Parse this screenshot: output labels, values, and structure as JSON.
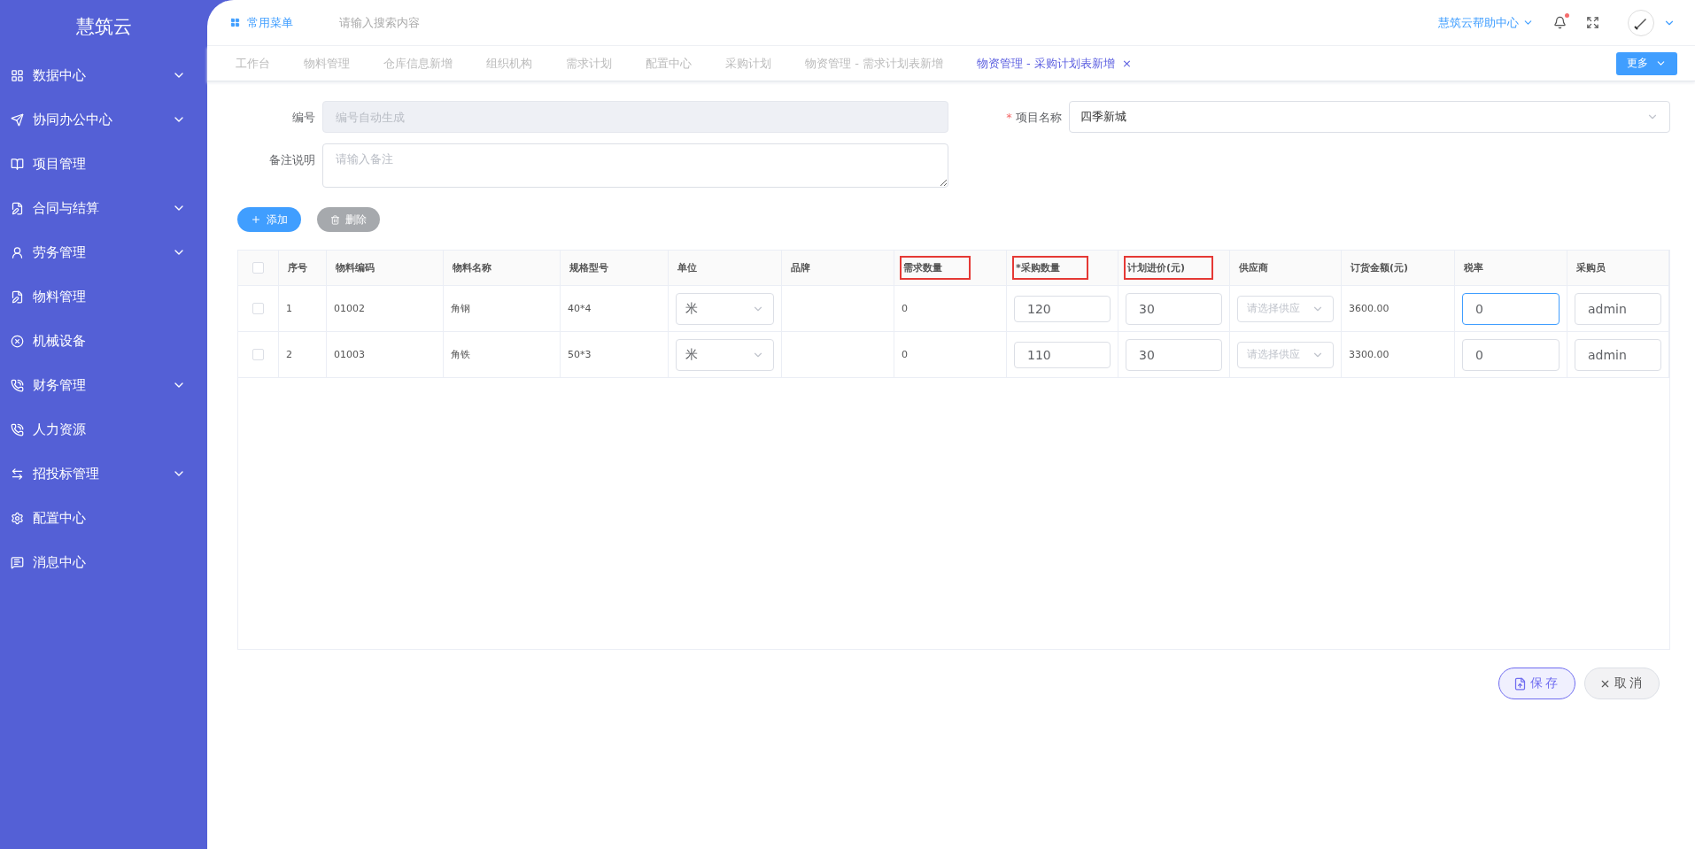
{
  "sidebar": {
    "logo": "慧筑云",
    "items": [
      {
        "label": "数据中心",
        "expandable": true
      },
      {
        "label": "协同办公中心",
        "expandable": true
      },
      {
        "label": "项目管理",
        "expandable": false
      },
      {
        "label": "合同与结算",
        "expandable": true
      },
      {
        "label": "劳务管理",
        "expandable": true
      },
      {
        "label": "物料管理",
        "expandable": false
      },
      {
        "label": "机械设备",
        "expandable": false
      },
      {
        "label": "财务管理",
        "expandable": true
      },
      {
        "label": "人力资源",
        "expandable": false
      },
      {
        "label": "招投标管理",
        "expandable": true
      },
      {
        "label": "配置中心",
        "expandable": false
      },
      {
        "label": "消息中心",
        "expandable": false
      }
    ]
  },
  "header": {
    "menu": "常用菜单",
    "search": {
      "placeholder": "请输入搜索内容"
    },
    "help": "慧筑云帮助中心",
    "notification": true
  },
  "tabs": [
    {
      "label": "工作台",
      "selected": false
    },
    {
      "label": "物料管理",
      "selected": false
    },
    {
      "label": "仓库信息新增",
      "selected": false
    },
    {
      "label": "组织机构",
      "selected": false
    },
    {
      "label": "需求计划",
      "selected": false
    },
    {
      "label": "配置中心",
      "selected": false
    },
    {
      "label": "采购计划",
      "selected": false
    },
    {
      "label": "物资管理 - 需求计划表新增",
      "selected": false
    },
    {
      "label": "物资管理 - 采购计划表新增",
      "selected": true,
      "close": "×"
    }
  ],
  "more_button": "更多",
  "form": {
    "number": {
      "label": "编号",
      "placeholder": "编号自动生成",
      "disabled": true
    },
    "project": {
      "label": "项目名称",
      "required": "*",
      "value": "四季新城"
    },
    "remark": {
      "label": "备注说明",
      "placeholder": "请输入备注"
    }
  },
  "actions": [
    {
      "label": "添加",
      "kind": "add"
    },
    {
      "label": "删除",
      "kind": "delete"
    }
  ],
  "table": {
    "all_checked": false,
    "columns": [
      {
        "label": "序号",
        "highlighted": false
      },
      {
        "label": "物料编码",
        "highlighted": false
      },
      {
        "label": "物料名称",
        "highlighted": false
      },
      {
        "label": "规格型号",
        "highlighted": false
      },
      {
        "label": "单位",
        "highlighted": false
      },
      {
        "label": "品牌",
        "highlighted": false
      },
      {
        "label": "需求数量",
        "highlighted": true
      },
      {
        "label": "*采购数量",
        "highlighted": true
      },
      {
        "label": "计划进价(元)",
        "highlighted": true
      },
      {
        "label": "供应商",
        "highlighted": false
      },
      {
        "label": "订货金额(元)",
        "highlighted": false
      },
      {
        "label": "税率",
        "highlighted": false
      },
      {
        "label": "采购员",
        "highlighted": false
      }
    ],
    "rows": [
      {
        "checked": false,
        "index": "1",
        "code": "01002",
        "name": "角钢",
        "spec": "40*4",
        "unit": "米",
        "demand": "0",
        "qty": "120",
        "price": "30",
        "supplier_placeholder": "请选择供应",
        "amount": "3600.00",
        "tax": "0",
        "tax_focused": true,
        "buyer": "admin"
      },
      {
        "checked": false,
        "index": "2",
        "code": "01003",
        "name": "角铁",
        "spec": "50*3",
        "unit": "米",
        "demand": "0",
        "qty": "110",
        "price": "30",
        "supplier_placeholder": "请选择供应",
        "amount": "3300.00",
        "tax": "0",
        "tax_focused": false,
        "buyer": "admin"
      }
    ]
  },
  "footer": [
    {
      "label": "保存",
      "kind": "save"
    },
    {
      "label": "取消",
      "kind": "cancel"
    }
  ]
}
